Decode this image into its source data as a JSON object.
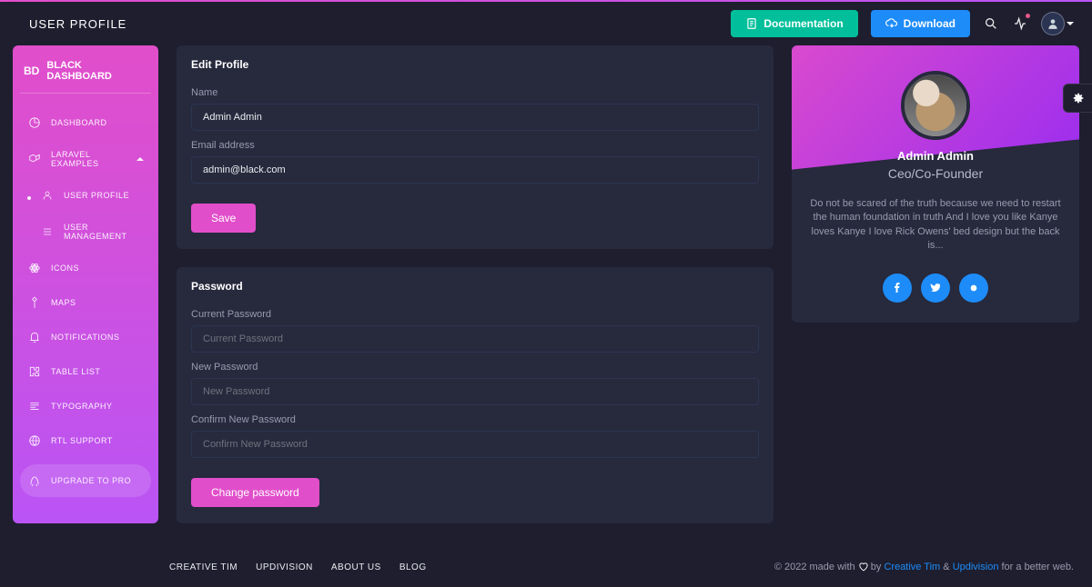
{
  "header": {
    "title": "USER PROFILE",
    "doc_label": "Documentation",
    "download_label": "Download"
  },
  "brand": {
    "short": "BD",
    "full": "BLACK DASHBOARD"
  },
  "sidebar": {
    "items": [
      {
        "label": "DASHBOARD"
      },
      {
        "label": "LARAVEL EXAMPLES"
      },
      {
        "label": "USER PROFILE"
      },
      {
        "label": "USER MANAGEMENT"
      },
      {
        "label": "ICONS"
      },
      {
        "label": "MAPS"
      },
      {
        "label": "NOTIFICATIONS"
      },
      {
        "label": "TABLE LIST"
      },
      {
        "label": "TYPOGRAPHY"
      },
      {
        "label": "RTL SUPPORT"
      },
      {
        "label": "UPGRADE TO PRO"
      }
    ]
  },
  "profile_form": {
    "title": "Edit Profile",
    "name_label": "Name",
    "name_value": "Admin Admin",
    "email_label": "Email address",
    "email_value": "admin@black.com",
    "save_label": "Save"
  },
  "password_form": {
    "title": "Password",
    "current_label": "Current Password",
    "current_placeholder": "Current Password",
    "new_label": "New Password",
    "new_placeholder": "New Password",
    "confirm_label": "Confirm New Password",
    "confirm_placeholder": "Confirm New Password",
    "change_label": "Change password"
  },
  "user_card": {
    "name": "Admin Admin",
    "role": "Ceo/Co-Founder",
    "bio": "Do not be scared of the truth because we need to restart the human foundation in truth And I love you like Kanye loves Kanye I love Rick Owens' bed design but the back is..."
  },
  "footer": {
    "links": [
      "CREATIVE TIM",
      "UPDIVISION",
      "ABOUT US",
      "BLOG"
    ],
    "copyright_prefix": "© 2022 made with ",
    "copyright_mid": " by ",
    "link1": "Creative Tim",
    "amp": " & ",
    "link2": "Updivision",
    "copyright_suffix": " for a better web."
  }
}
